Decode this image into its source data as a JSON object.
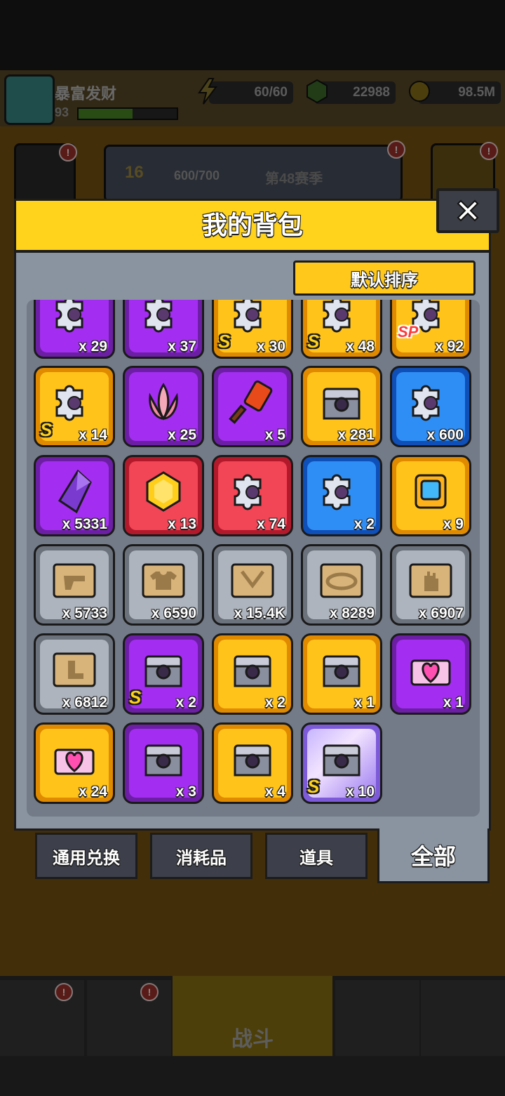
{
  "player": {
    "name": "暴富发财",
    "level": "93",
    "xp_fraction": 0.55
  },
  "resources": [
    {
      "icon": "energy-bolt-icon",
      "value": "60/60"
    },
    {
      "icon": "green-gem-icon",
      "value": "22988"
    },
    {
      "icon": "gold-coin-icon",
      "value": "98.5M"
    }
  ],
  "season": {
    "level": "16",
    "progress": "600/700",
    "label": "第48赛季"
  },
  "modal": {
    "title": "我的背包",
    "sort_label": "默认排序",
    "close_icon": "close-icon"
  },
  "items": [
    {
      "rarity": "purple",
      "icon": "puzzle-piece-icon",
      "count": "x 29",
      "badge": ""
    },
    {
      "rarity": "purple",
      "icon": "puzzle-piece-icon",
      "count": "x 37",
      "badge": ""
    },
    {
      "rarity": "gold",
      "icon": "puzzle-piece-icon",
      "count": "x 30",
      "badge": "S"
    },
    {
      "rarity": "gold",
      "icon": "puzzle-piece-icon",
      "count": "x 48",
      "badge": "S"
    },
    {
      "rarity": "gold",
      "icon": "puzzle-piece-icon",
      "count": "x 92",
      "badge": "SP"
    },
    {
      "rarity": "gold",
      "icon": "puzzle-piece-icon",
      "count": "x 14",
      "badge": "S"
    },
    {
      "rarity": "purple",
      "icon": "lotus-icon",
      "count": "x 25",
      "badge": ""
    },
    {
      "rarity": "purple",
      "icon": "hammer-icon",
      "count": "x 5",
      "badge": ""
    },
    {
      "rarity": "gold",
      "icon": "chest-icon",
      "count": "x 281",
      "badge": ""
    },
    {
      "rarity": "blue",
      "icon": "puzzle-piece-icon",
      "count": "x 600",
      "badge": ""
    },
    {
      "rarity": "purple",
      "icon": "purple-crystal-icon",
      "count": "x 5331",
      "badge": ""
    },
    {
      "rarity": "red",
      "icon": "gold-gem-icon",
      "count": "x 13",
      "badge": ""
    },
    {
      "rarity": "red",
      "icon": "puzzle-piece-icon",
      "count": "x 74",
      "badge": ""
    },
    {
      "rarity": "blue",
      "icon": "puzzle-piece-icon",
      "count": "x 2",
      "badge": ""
    },
    {
      "rarity": "gold",
      "icon": "device-icon",
      "count": "x 9",
      "badge": ""
    },
    {
      "rarity": "grey",
      "icon": "blueprint-gun-icon",
      "count": "x 5733",
      "badge": ""
    },
    {
      "rarity": "grey",
      "icon": "blueprint-shirt-icon",
      "count": "x 6590",
      "badge": ""
    },
    {
      "rarity": "grey",
      "icon": "blueprint-necklace-icon",
      "count": "x 15.4K",
      "badge": ""
    },
    {
      "rarity": "grey",
      "icon": "blueprint-belt-icon",
      "count": "x 8289",
      "badge": ""
    },
    {
      "rarity": "grey",
      "icon": "blueprint-glove-icon",
      "count": "x 6907",
      "badge": ""
    },
    {
      "rarity": "grey",
      "icon": "blueprint-boot-icon",
      "count": "x 6812",
      "badge": ""
    },
    {
      "rarity": "purple",
      "icon": "chest-icon",
      "count": "x 2",
      "badge": "S"
    },
    {
      "rarity": "gold",
      "icon": "chest-icon",
      "count": "x 2",
      "badge": ""
    },
    {
      "rarity": "gold",
      "icon": "chest-icon",
      "count": "x 1",
      "badge": ""
    },
    {
      "rarity": "purple",
      "icon": "heart-chest-icon",
      "count": "x 1",
      "badge": ""
    },
    {
      "rarity": "gold",
      "icon": "heart-chest-icon",
      "count": "x 24",
      "badge": ""
    },
    {
      "rarity": "purple",
      "icon": "chest-icon",
      "count": "x 3",
      "badge": ""
    },
    {
      "rarity": "gold",
      "icon": "chest-icon",
      "count": "x 4",
      "badge": ""
    },
    {
      "rarity": "holo",
      "icon": "chest-icon",
      "count": "x 10",
      "badge": "S"
    }
  ],
  "tabs": [
    {
      "label": "通用兑换"
    },
    {
      "label": "消耗品"
    },
    {
      "label": "道具"
    },
    {
      "label": "全部",
      "active": true
    }
  ],
  "bottom_nav": {
    "battle_label": "战斗"
  },
  "colors": {
    "header_yellow": "#ffd21b",
    "panel_grey": "#8a93a0",
    "purple": "#a32ef1",
    "gold": "#ffc31a",
    "blue": "#2f8ef5",
    "red": "#f24556",
    "grey": "#aeb4bd"
  }
}
